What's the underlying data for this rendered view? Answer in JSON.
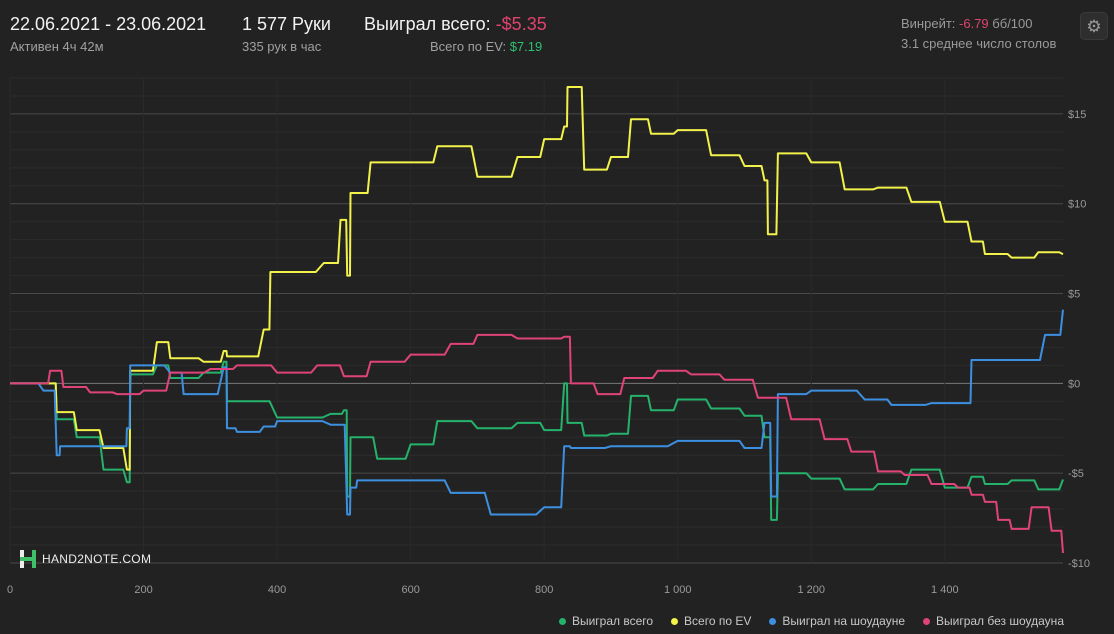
{
  "header": {
    "date_range": "22.06.2021 - 23.06.2021",
    "active": "Активен 4ч 42м",
    "hands": "1 577 Руки",
    "hands_per_hour": "335 рук в час",
    "won_total_label": "Выиграл всего:",
    "won_total_value": "-$5.35",
    "ev_label": "Всего по EV:",
    "ev_value": "$7.19",
    "winrate_label": "Винрейт:",
    "winrate_value": "-6.79",
    "winrate_unit": "бб/100",
    "avg_tables": "3.1 среднее число столов"
  },
  "logo_text": "HAND2NOTE.COM",
  "colors": {
    "background": "#222222",
    "won_total": "#25b36b",
    "ev": "#f2f24a",
    "showdown": "#3d8fe0",
    "non_showdown": "#e0437a",
    "negative": "#e0436f",
    "positive": "#2fbf71"
  },
  "chart_data": {
    "type": "line",
    "xlim": [
      0,
      1577
    ],
    "ylim": [
      -10,
      17
    ],
    "x_ticks": [
      0,
      200,
      400,
      600,
      800,
      1000,
      1200,
      1400
    ],
    "x_tick_labels": [
      "0",
      "200",
      "400",
      "600",
      "800",
      "1 000",
      "1 200",
      "1 400"
    ],
    "y_ticks": [
      15,
      10,
      5,
      0,
      -5,
      -10
    ],
    "y_tick_labels": [
      "$15",
      "$10",
      "$5",
      "$0",
      "-$5",
      "-$10"
    ],
    "grid": true,
    "legend_position": "bottom-right",
    "series": [
      {
        "name": "Выиграл всего",
        "color": "#25b36b",
        "x": [
          0,
          30,
          60,
          70,
          100,
          140,
          175,
          180,
          220,
          240,
          290,
          320,
          325,
          400,
          480,
          500,
          505,
          510,
          550,
          600,
          640,
          700,
          760,
          800,
          830,
          835,
          860,
          900,
          930,
          960,
          1000,
          1050,
          1100,
          1130,
          1140,
          1150,
          1200,
          1250,
          1300,
          1350,
          1400,
          1440,
          1460,
          1500,
          1540,
          1577
        ],
        "y": [
          0,
          0,
          0,
          -2,
          -3,
          -4.8,
          -5.5,
          0.5,
          1,
          0.3,
          0.6,
          1.2,
          -1,
          -1.9,
          -1.7,
          -1.5,
          -6.3,
          -3,
          -4.2,
          -3.4,
          -2.1,
          -2.5,
          -2.2,
          -2.6,
          0,
          -2.2,
          -2.9,
          -2.8,
          -0.7,
          -1.5,
          -0.9,
          -1.4,
          -1.8,
          -3,
          -7.6,
          -5,
          -5.3,
          -5.9,
          -5.6,
          -4.8,
          -5.8,
          -5.2,
          -5.6,
          -5.4,
          -5.9,
          -5.35
        ]
      },
      {
        "name": "Всего по EV",
        "color": "#f2f24a",
        "x": [
          0,
          30,
          60,
          70,
          100,
          140,
          175,
          180,
          220,
          240,
          290,
          320,
          325,
          380,
          390,
          470,
          495,
          505,
          510,
          540,
          600,
          640,
          700,
          760,
          800,
          830,
          835,
          860,
          900,
          930,
          960,
          1000,
          1050,
          1100,
          1130,
          1135,
          1150,
          1200,
          1250,
          1300,
          1350,
          1400,
          1440,
          1460,
          1500,
          1540,
          1577
        ],
        "y": [
          0,
          0,
          0,
          -1.6,
          -2.6,
          -3.6,
          -4.8,
          0.7,
          2.3,
          1.4,
          1.2,
          1.8,
          1.5,
          3,
          6.2,
          6.7,
          9.1,
          6,
          10.6,
          12.3,
          12.3,
          13.2,
          11.5,
          12.6,
          13.6,
          14.3,
          16.5,
          11.9,
          12.6,
          14.7,
          13.9,
          14.1,
          12.7,
          12.1,
          11.3,
          8.3,
          12.8,
          12.3,
          10.8,
          10.9,
          10.1,
          9,
          7.9,
          7.2,
          7,
          7.3,
          7.19
        ]
      },
      {
        "name": "Выиграл на шоудауне",
        "color": "#3d8fe0",
        "x": [
          0,
          50,
          70,
          75,
          170,
          175,
          180,
          240,
          260,
          320,
          325,
          340,
          380,
          400,
          480,
          505,
          510,
          520,
          600,
          660,
          720,
          800,
          830,
          840,
          900,
          1000,
          1050,
          1100,
          1130,
          1140,
          1150,
          1200,
          1280,
          1320,
          1380,
          1430,
          1440,
          1500,
          1550,
          1577
        ],
        "y": [
          0,
          -0.4,
          -4,
          -3.5,
          -3.5,
          -2.5,
          1,
          0.6,
          -0.6,
          0.9,
          -2.5,
          -2.7,
          -2.4,
          -2.1,
          -2.3,
          -7.3,
          -5.8,
          -5.4,
          -5.4,
          -6.1,
          -7.3,
          -6.9,
          -3.5,
          -3.6,
          -3.5,
          -3.2,
          -3.2,
          -3.6,
          -2.2,
          -6.3,
          -0.6,
          -0.4,
          -0.9,
          -1.2,
          -1.1,
          -1.1,
          1.3,
          1.3,
          2.7,
          4.1
        ]
      },
      {
        "name": "Выиграл без шоудауна",
        "color": "#e0437a",
        "x": [
          0,
          40,
          60,
          80,
          120,
          160,
          200,
          240,
          300,
          340,
          400,
          460,
          500,
          540,
          600,
          660,
          700,
          760,
          800,
          830,
          840,
          880,
          920,
          970,
          1020,
          1070,
          1120,
          1170,
          1220,
          1260,
          1300,
          1340,
          1380,
          1420,
          1440,
          1460,
          1480,
          1500,
          1530,
          1560,
          1577
        ],
        "y": [
          0,
          0,
          0.7,
          -0.2,
          -0.5,
          -0.6,
          -0.4,
          0.6,
          0.8,
          1,
          0.6,
          1,
          0.4,
          1.2,
          1.6,
          2.2,
          2.7,
          2.5,
          2.5,
          2.6,
          0,
          -0.6,
          0.3,
          0.7,
          0.5,
          0.2,
          -0.8,
          -2,
          -3.1,
          -3.8,
          -4.9,
          -5.1,
          -5.6,
          -5.8,
          -6.2,
          -6.6,
          -7.6,
          -8.1,
          -6.9,
          -8.2,
          -9.45
        ]
      }
    ]
  }
}
